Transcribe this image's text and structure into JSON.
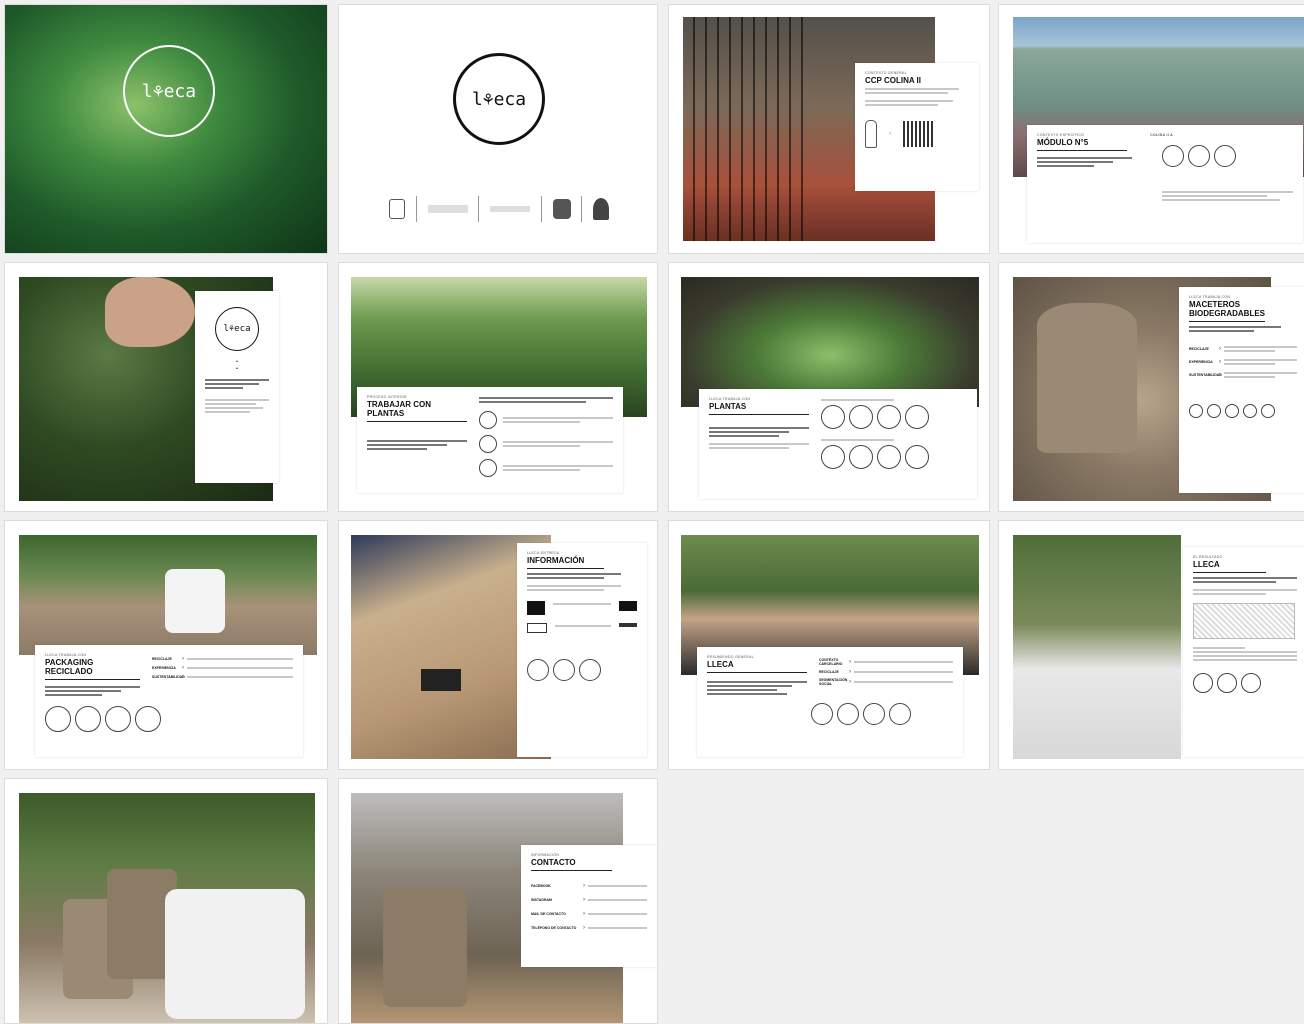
{
  "slides": {
    "s1": {
      "logo": "l⚘eca"
    },
    "s2": {
      "logo": "l⚘eca"
    },
    "s3": {
      "kicker": "CONTEXTO GENERAL",
      "title": "CCP COLINA II"
    },
    "s4": {
      "kicker": "CONTEXTO ESPECÍFICO",
      "title": "MÓDULO N°5",
      "side_title": "COLINA II A"
    },
    "s5": {
      "logo": "l⚘eca"
    },
    "s6": {
      "kicker": "PROCESO INTERIOR",
      "title": "TRABAJAR CON PLANTAS"
    },
    "s7": {
      "kicker": "LLECA TRABAJA CON",
      "title": "PLANTAS"
    },
    "s8": {
      "kicker": "LLECA TRABAJA CON",
      "title": "MACETEROS BIODEGRADABLES",
      "rows": [
        "RECICLAJE",
        "EXPERIENCIA",
        "SUSTENTABILIDAD"
      ]
    },
    "s9": {
      "kicker": "LLECA TRABAJA CON",
      "title": "PACKAGING RECICLADO",
      "rows": [
        "RECICLAJE",
        "EXPERIENCIA",
        "SUSTENTABILIDAD"
      ]
    },
    "s10": {
      "kicker": "LLECA ENTREGA",
      "title": "INFORMACIÓN"
    },
    "s11": {
      "kicker": "RESUMIENDO GENERAL",
      "title": "LLECA",
      "rows": [
        "CONTEXTO CARCELARIO",
        "RECICLAJE",
        "SEGMENTACIÓN SOCIAL"
      ]
    },
    "s12": {
      "kicker": "EL RESULTADO",
      "title": "LLECA"
    },
    "s14": {
      "kicker": "INFORMACIÓN",
      "title": "CONTACTO",
      "rows": [
        "FACEBOOK",
        "INSTAGRAM",
        "MAIL DE CONTACTO",
        "TELÉFONO DE CONTACTO"
      ]
    }
  },
  "colors": {
    "accent": "#111111",
    "plant_green": "#3f7a3a",
    "pot": "#9b8a73"
  }
}
